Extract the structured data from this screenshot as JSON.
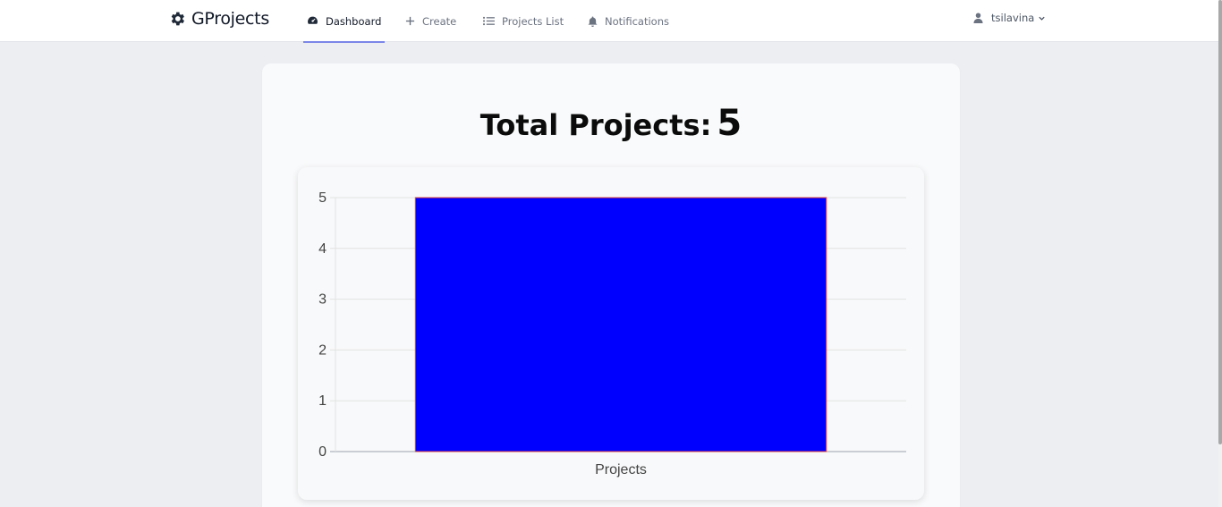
{
  "nav": {
    "brand": "GProjects",
    "items": [
      {
        "label": "Dashboard",
        "icon": "dashboard-icon",
        "active": true
      },
      {
        "label": "Create",
        "icon": "plus-icon",
        "active": false
      },
      {
        "label": "Projects List",
        "icon": "list-icon",
        "active": false
      },
      {
        "label": "Notifications",
        "icon": "bell-icon",
        "active": false
      }
    ],
    "user": "tsilavina"
  },
  "main": {
    "total_label": "Total Projects:",
    "total_value": "5"
  },
  "colors": {
    "bar_fill": "#0000ff",
    "bar_border": "#e0453a",
    "active_underline": "#7c86e8"
  },
  "chart_data": {
    "type": "bar",
    "categories": [
      "Projects"
    ],
    "values": [
      5
    ],
    "ylim": [
      0,
      5
    ],
    "yticks": [
      "0",
      "1",
      "2",
      "3",
      "4",
      "5"
    ],
    "grid": true
  }
}
